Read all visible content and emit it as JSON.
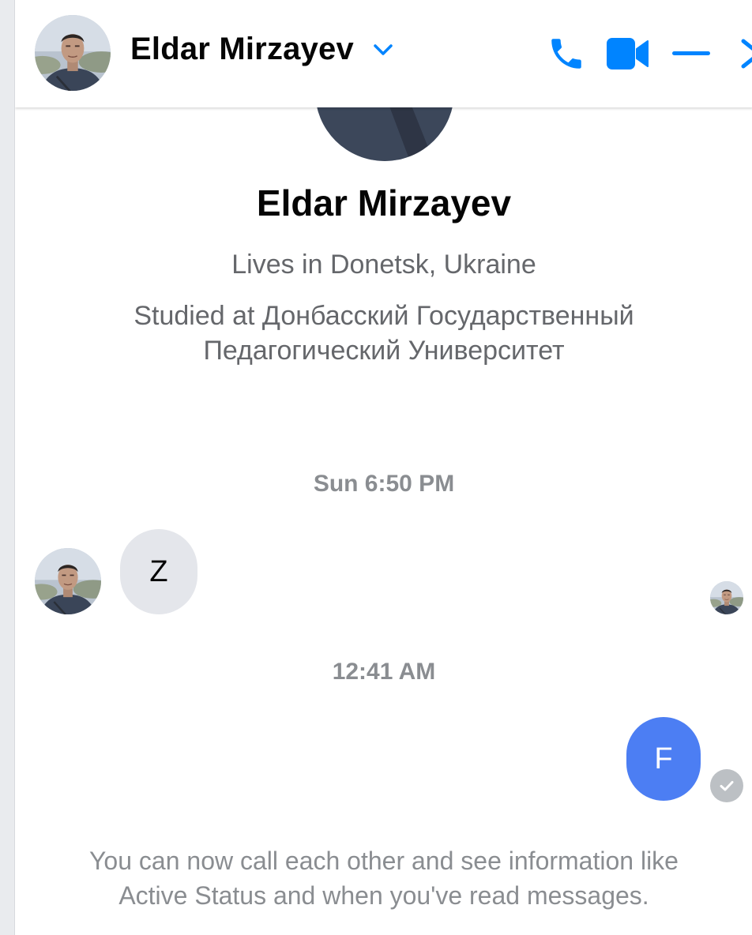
{
  "header": {
    "name": "Eldar Mirzayev"
  },
  "profile": {
    "name": "Eldar Mirzayev",
    "lives": "Lives in Donetsk, Ukraine",
    "studied": "Studied at Донбасский Государственный Педагогический Университет"
  },
  "messages": [
    {
      "timestamp": "Sun 6:50 PM",
      "direction": "incoming",
      "text": "Z"
    },
    {
      "timestamp": "12:41 AM",
      "direction": "outgoing",
      "text": "F"
    }
  ],
  "notice": "You can now call each other and see information like Active Status and when you've read messages.",
  "icons": {
    "header": [
      "chevron-down-icon",
      "phone-icon",
      "video-camera-icon",
      "minimize-icon",
      "close-icon"
    ],
    "status": "check-icon"
  },
  "colors": {
    "accent": "#0084ff",
    "outgoing_bubble": "#4c7ef3",
    "incoming_bubble": "#e4e6eb",
    "secondary_text": "#65676b",
    "muted_text": "#8a8d91"
  }
}
